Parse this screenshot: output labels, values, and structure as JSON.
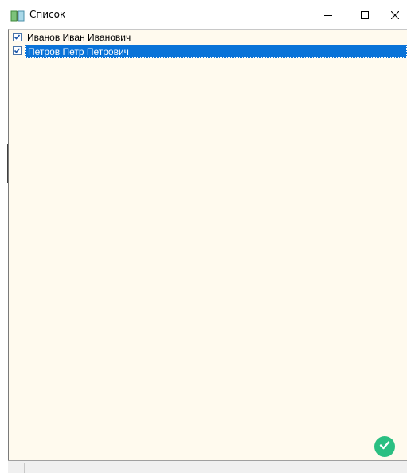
{
  "window": {
    "title": "Список",
    "icon": "book-icon",
    "controls": {
      "minimize": "minimize-icon",
      "maximize": "maximize-icon",
      "close": "close-icon"
    }
  },
  "list": {
    "items": [
      {
        "label": "Иванов Иван Иванович",
        "checked": true,
        "selected": false
      },
      {
        "label": "Петров Петр Петрович",
        "checked": true,
        "selected": true
      }
    ]
  },
  "accept_button": {
    "icon": "checkmark-icon"
  },
  "colors": {
    "list_background": "#fffaee",
    "selection": "#0a73d8",
    "accept": "#2bbf82"
  }
}
